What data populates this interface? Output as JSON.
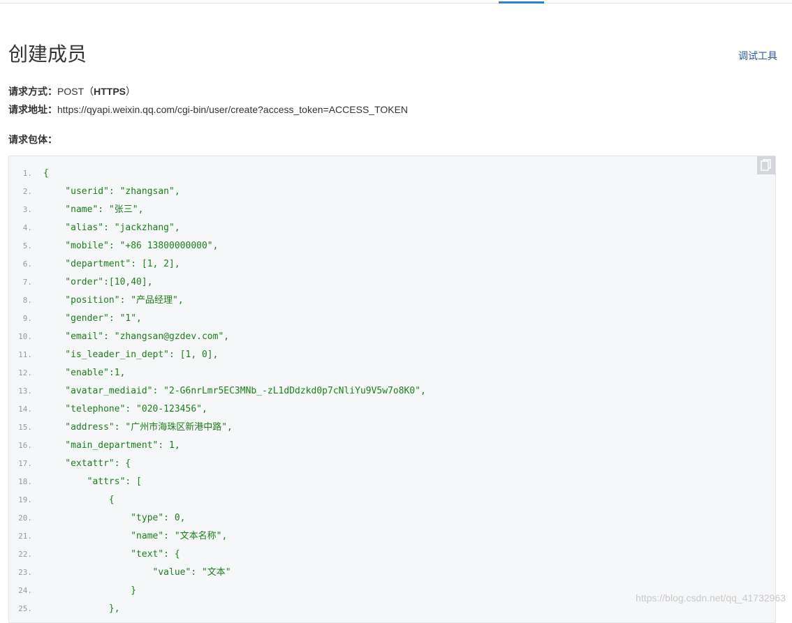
{
  "header": {
    "title": "创建成员",
    "debug_tool": "调试工具"
  },
  "request": {
    "method_label": "请求方式：",
    "method_prefix": "POST（",
    "method_protocol": "HTTPS",
    "method_suffix": "）",
    "url_label": "请求地址：",
    "url": "https://qyapi.weixin.qq.com/cgi-bin/user/create?access_token=ACCESS_TOKEN",
    "body_label": "请求包体："
  },
  "code": {
    "copy_icon": "copy-icon",
    "lines": [
      {
        "no": "1.",
        "text": "{"
      },
      {
        "no": "2.",
        "text": "    \"userid\": \"zhangsan\","
      },
      {
        "no": "3.",
        "text": "    \"name\": \"张三\","
      },
      {
        "no": "4.",
        "text": "    \"alias\": \"jackzhang\","
      },
      {
        "no": "5.",
        "text": "    \"mobile\": \"+86 13800000000\","
      },
      {
        "no": "6.",
        "text": "    \"department\": [1, 2],"
      },
      {
        "no": "7.",
        "text": "    \"order\":[10,40],"
      },
      {
        "no": "8.",
        "text": "    \"position\": \"产品经理\","
      },
      {
        "no": "9.",
        "text": "    \"gender\": \"1\","
      },
      {
        "no": "10.",
        "text": "    \"email\": \"zhangsan@gzdev.com\","
      },
      {
        "no": "11.",
        "text": "    \"is_leader_in_dept\": [1, 0],"
      },
      {
        "no": "12.",
        "text": "    \"enable\":1,"
      },
      {
        "no": "13.",
        "text": "    \"avatar_mediaid\": \"2-G6nrLmr5EC3MNb_-zL1dDdzkd0p7cNliYu9V5w7o8K0\","
      },
      {
        "no": "14.",
        "text": "    \"telephone\": \"020-123456\","
      },
      {
        "no": "15.",
        "text": "    \"address\": \"广州市海珠区新港中路\","
      },
      {
        "no": "16.",
        "text": "    \"main_department\": 1,"
      },
      {
        "no": "17.",
        "text": "    \"extattr\": {"
      },
      {
        "no": "18.",
        "text": "        \"attrs\": ["
      },
      {
        "no": "19.",
        "text": "            {"
      },
      {
        "no": "20.",
        "text": "                \"type\": 0,"
      },
      {
        "no": "21.",
        "text": "                \"name\": \"文本名称\","
      },
      {
        "no": "22.",
        "text": "                \"text\": {"
      },
      {
        "no": "23.",
        "text": "                    \"value\": \"文本\""
      },
      {
        "no": "24.",
        "text": "                }"
      },
      {
        "no": "25.",
        "text": "            },"
      }
    ]
  },
  "watermark": "https://blog.csdn.net/qq_41732963"
}
